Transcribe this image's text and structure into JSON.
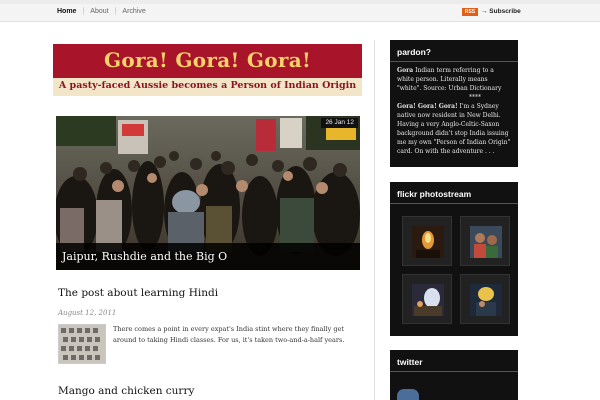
{
  "nav": {
    "items": [
      "Home",
      "About",
      "Archive"
    ],
    "rss_label": "RSS",
    "subscribe_label": "→ Subscribe"
  },
  "banner": {
    "title": "Gora! Gora! Gora!",
    "subtitle": "A pasty-faced Aussie becomes a Person of Indian Origin"
  },
  "featured": {
    "date": "26 Jan 12",
    "caption": "Jaipur, Rushdie and the Big O"
  },
  "posts": [
    {
      "title": "The post about learning Hindi",
      "date": "August 12, 2011",
      "excerpt": "There comes a point in every expat's India stint where they finally get around to taking Hindi classes. For us, it's taken two-and-a-half years."
    },
    {
      "title": "Mango and chicken curry"
    }
  ],
  "sidebar": {
    "pardon": {
      "title": "pardon?",
      "def_term": "Gora",
      "def_text": " Indian term referring to a white person. Literally means \"white\". Source: Urban Dictionary",
      "stars": "****",
      "bio_term": "Gora! Gora! Gora!",
      "bio_text": " I'm a Sydney native now resident in New Delhi. Having a very Anglo-Celtic-Saxon background didn't stop India issuing me my own \"Person of Indian Origin\" card. On with the adventure . . ."
    },
    "flickr": {
      "title": "flickr photostream"
    },
    "twitter": {
      "title": "twitter"
    }
  },
  "colors": {
    "banner_red": "#a8142a",
    "banner_gold": "#f6d36a",
    "rss_orange": "#e0601a",
    "widget_bg": "#111111"
  }
}
